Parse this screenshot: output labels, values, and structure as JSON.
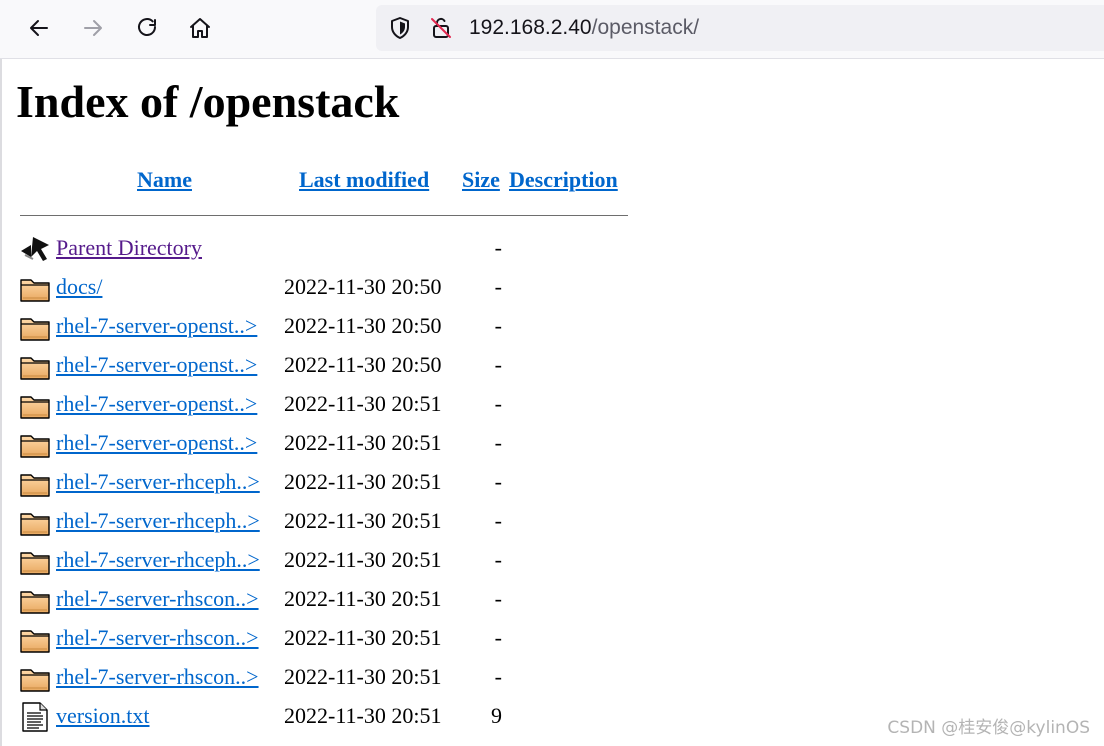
{
  "browser": {
    "url_host": "192.168.2.40",
    "url_path": "/openstack/"
  },
  "page": {
    "title": "Index of /openstack"
  },
  "table": {
    "headers": {
      "name": "Name",
      "last_modified": "Last modified",
      "size": "Size",
      "description": "Description"
    },
    "rows": [
      {
        "icon": "back-icon",
        "name": "Parent Directory",
        "date": "",
        "size": "-"
      },
      {
        "icon": "folder-icon",
        "name": "docs/",
        "date": "2022-11-30 20:50",
        "size": "-"
      },
      {
        "icon": "folder-icon",
        "name": "rhel-7-server-openst..>",
        "date": "2022-11-30 20:50",
        "size": "-"
      },
      {
        "icon": "folder-icon",
        "name": "rhel-7-server-openst..>",
        "date": "2022-11-30 20:50",
        "size": "-"
      },
      {
        "icon": "folder-icon",
        "name": "rhel-7-server-openst..>",
        "date": "2022-11-30 20:51",
        "size": "-"
      },
      {
        "icon": "folder-icon",
        "name": "rhel-7-server-openst..>",
        "date": "2022-11-30 20:51",
        "size": "-"
      },
      {
        "icon": "folder-icon",
        "name": "rhel-7-server-rhceph..>",
        "date": "2022-11-30 20:51",
        "size": "-"
      },
      {
        "icon": "folder-icon",
        "name": "rhel-7-server-rhceph..>",
        "date": "2022-11-30 20:51",
        "size": "-"
      },
      {
        "icon": "folder-icon",
        "name": "rhel-7-server-rhceph..>",
        "date": "2022-11-30 20:51",
        "size": "-"
      },
      {
        "icon": "folder-icon",
        "name": "rhel-7-server-rhscon..>",
        "date": "2022-11-30 20:51",
        "size": "-"
      },
      {
        "icon": "folder-icon",
        "name": "rhel-7-server-rhscon..>",
        "date": "2022-11-30 20:51",
        "size": "-"
      },
      {
        "icon": "folder-icon",
        "name": "rhel-7-server-rhscon..>",
        "date": "2022-11-30 20:51",
        "size": "-"
      },
      {
        "icon": "text-file-icon",
        "name": "version.txt",
        "date": "2022-11-30 20:51",
        "size": "9"
      }
    ]
  },
  "watermark": "CSDN @桂安俊@kylinOS",
  "colors": {
    "link": "#0066cc",
    "visited": "#551a8b"
  }
}
